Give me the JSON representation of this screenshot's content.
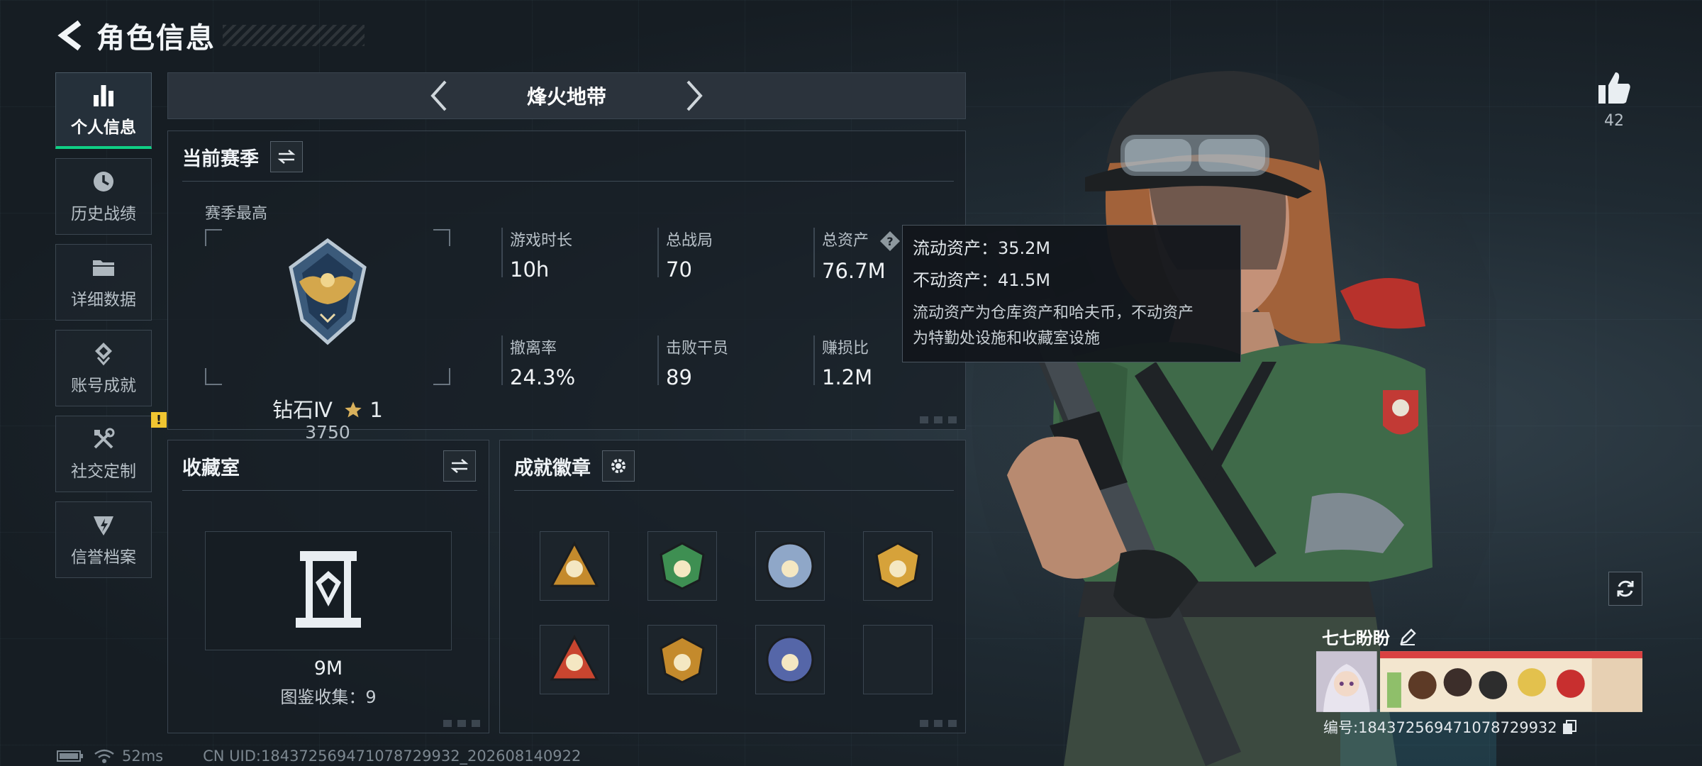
{
  "header": {
    "title": "角色信息"
  },
  "sidebar": {
    "items": [
      {
        "label": "个人信息",
        "icon": "bar-chart-icon",
        "active": true
      },
      {
        "label": "历史战绩",
        "icon": "history-icon"
      },
      {
        "label": "详细数据",
        "icon": "folder-icon"
      },
      {
        "label": "账号成就",
        "icon": "achievement-icon"
      },
      {
        "label": "社交定制",
        "icon": "tools-icon",
        "badge": "!"
      },
      {
        "label": "信誉档案",
        "icon": "credit-icon"
      }
    ]
  },
  "mode": {
    "title": "烽火地带"
  },
  "season": {
    "title": "当前赛季",
    "best_label": "赛季最高",
    "rank_name": "钻石Ⅳ",
    "rank_stars": "1",
    "rank_points": "3750",
    "stats": [
      {
        "label": "游戏时长",
        "value": "10h"
      },
      {
        "label": "总战局",
        "value": "70"
      },
      {
        "label": "总资产",
        "value": "76.7M"
      },
      {
        "label": "撤离率",
        "value": "24.3%"
      },
      {
        "label": "击败干员",
        "value": "89"
      },
      {
        "label": "赚损比",
        "value": "1.2M"
      }
    ]
  },
  "tooltip": {
    "liquid": "流动资产：35.2M",
    "fixed": "不动资产：41.5M",
    "note_line1": "流动资产为仓库资产和哈夫币，不动资产",
    "note_line2": "为特勤处设施和收藏室设施"
  },
  "collection": {
    "title": "收藏室",
    "value": "9M",
    "count": "图鉴收集：9"
  },
  "achievements": {
    "title": "成就徽章",
    "badges": [
      {
        "color": "#c48a2c"
      },
      {
        "color": "#3e8f52"
      },
      {
        "color": "#8fa7c8"
      },
      {
        "color": "#d6a23a"
      },
      {
        "color": "#c9452f"
      },
      {
        "color": "#c48a2c"
      },
      {
        "color": "#5566a8"
      },
      {
        "color": ""
      }
    ]
  },
  "right": {
    "likes": "42",
    "player_name": "七七盼盼",
    "player_uid": "编号:18437256947107872993​2"
  },
  "status": {
    "ping": "52ms",
    "uid_line": "CN UID:18437256947107872993​2_202608140922"
  },
  "colors": {
    "accent": "#0fcf85",
    "panel_border": "#3a4550",
    "warning": "#f0c531"
  }
}
